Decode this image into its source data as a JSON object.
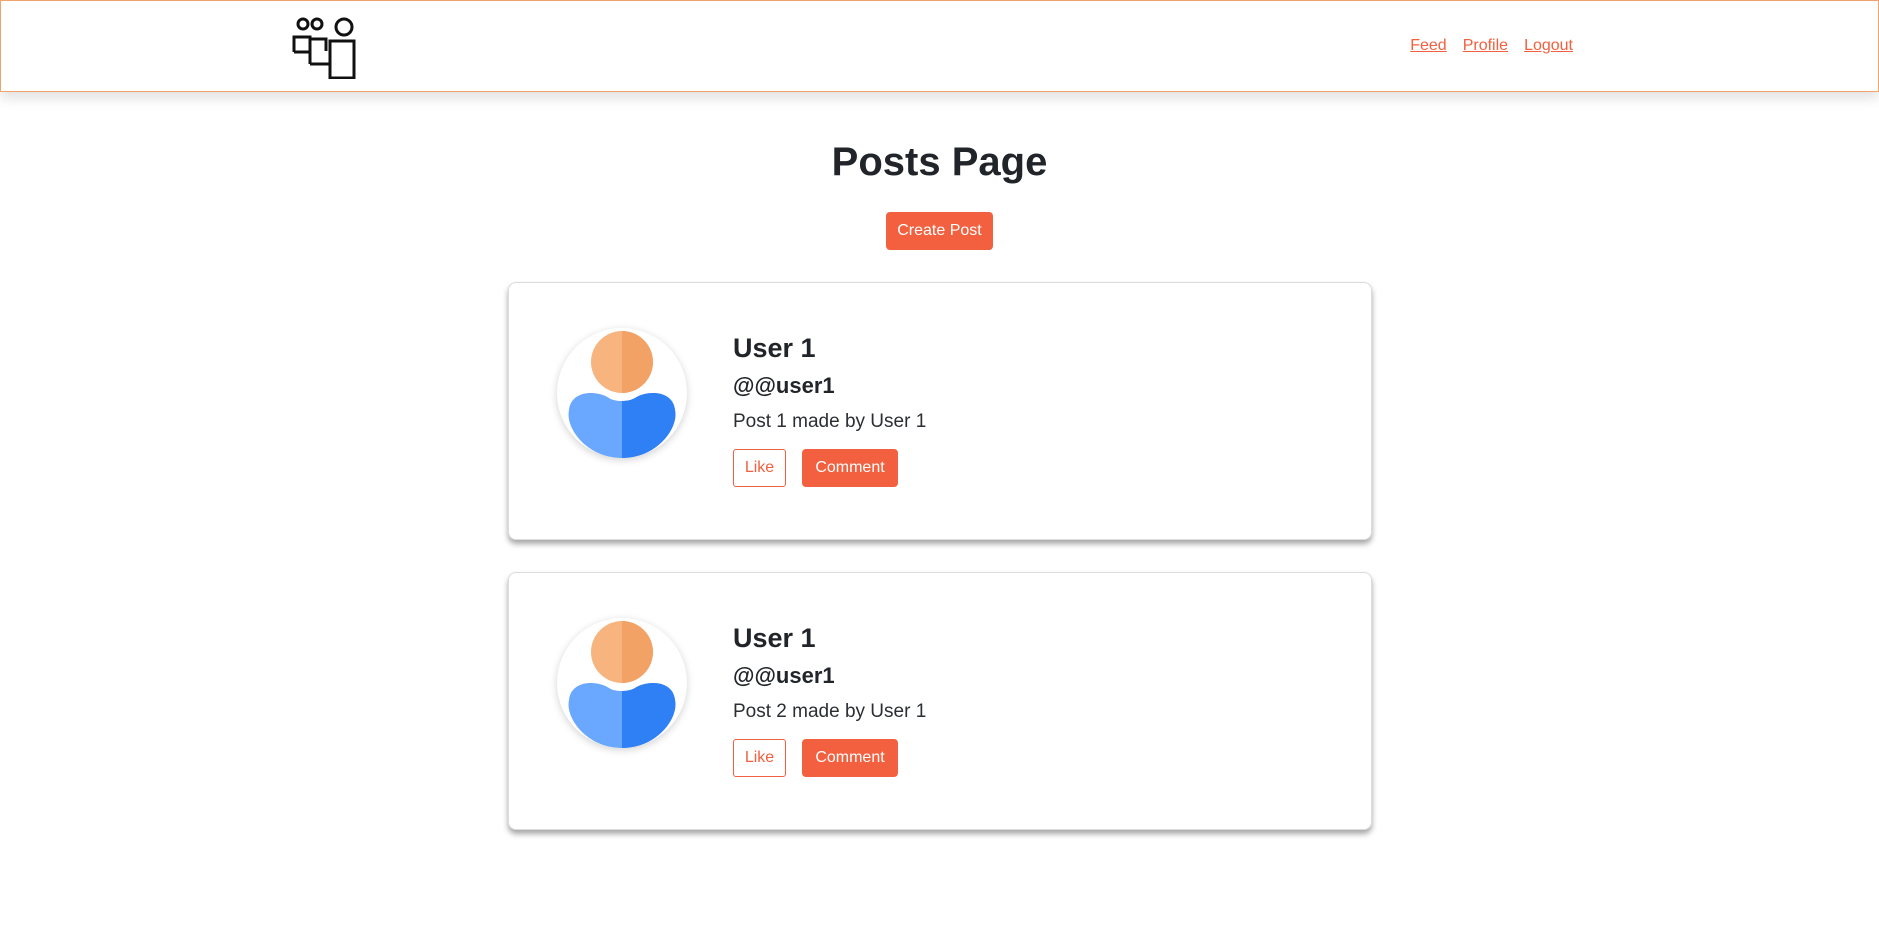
{
  "nav": {
    "logo_icon": "people-group-icon",
    "links": [
      "Feed",
      "Profile",
      "Logout"
    ]
  },
  "page": {
    "title": "Posts Page",
    "create_button": "Create Post"
  },
  "posts": [
    {
      "name": "User 1",
      "handle": "@@user1",
      "text": "Post 1 made by User 1",
      "like_label": "Like",
      "comment_label": "Comment",
      "avatar_icon": "user-avatar-icon"
    },
    {
      "name": "User 1",
      "handle": "@@user1",
      "text": "Post 2 made by User 1",
      "like_label": "Like",
      "comment_label": "Comment",
      "avatar_icon": "user-avatar-icon"
    }
  ],
  "colors": {
    "accent": "#f2603f",
    "nav_border": "#f0a36c",
    "avatar_head": "#f5a86e",
    "avatar_body_light": "#6aa8ff",
    "avatar_body_dark": "#2f7ff5"
  }
}
